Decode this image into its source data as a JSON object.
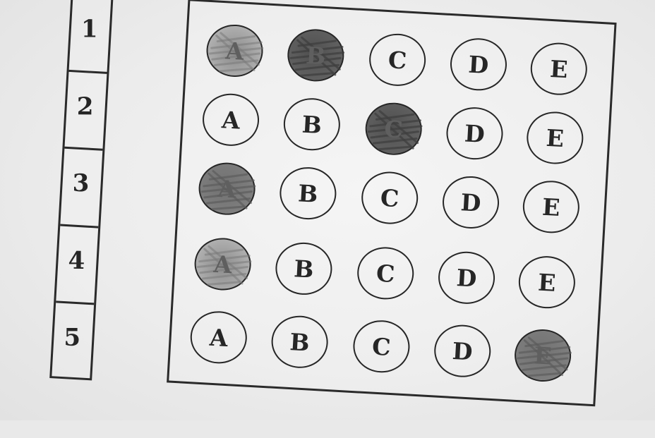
{
  "question_numbers": [
    "1",
    "2",
    "3",
    "4",
    "5"
  ],
  "answers": [
    {
      "number": "1",
      "options": [
        {
          "letter": "A",
          "marked": true,
          "shade": "light"
        },
        {
          "letter": "B",
          "marked": true,
          "shade": "dark"
        },
        {
          "letter": "C",
          "marked": false,
          "shade": "none"
        },
        {
          "letter": "D",
          "marked": false,
          "shade": "none"
        },
        {
          "letter": "E",
          "marked": false,
          "shade": "none"
        }
      ]
    },
    {
      "number": "2",
      "options": [
        {
          "letter": "A",
          "marked": false,
          "shade": "none"
        },
        {
          "letter": "B",
          "marked": false,
          "shade": "none"
        },
        {
          "letter": "C",
          "marked": true,
          "shade": "dark"
        },
        {
          "letter": "D",
          "marked": false,
          "shade": "none"
        },
        {
          "letter": "E",
          "marked": false,
          "shade": "none"
        }
      ]
    },
    {
      "number": "3",
      "options": [
        {
          "letter": "A",
          "marked": true,
          "shade": "medium"
        },
        {
          "letter": "B",
          "marked": false,
          "shade": "none"
        },
        {
          "letter": "C",
          "marked": false,
          "shade": "none"
        },
        {
          "letter": "D",
          "marked": false,
          "shade": "none"
        },
        {
          "letter": "E",
          "marked": false,
          "shade": "none"
        }
      ]
    },
    {
      "number": "4",
      "options": [
        {
          "letter": "A",
          "marked": true,
          "shade": "light"
        },
        {
          "letter": "B",
          "marked": false,
          "shade": "none"
        },
        {
          "letter": "C",
          "marked": false,
          "shade": "none"
        },
        {
          "letter": "D",
          "marked": false,
          "shade": "none"
        },
        {
          "letter": "E",
          "marked": false,
          "shade": "none"
        }
      ]
    },
    {
      "number": "5",
      "options": [
        {
          "letter": "A",
          "marked": false,
          "shade": "none"
        },
        {
          "letter": "B",
          "marked": false,
          "shade": "none"
        },
        {
          "letter": "C",
          "marked": false,
          "shade": "none"
        },
        {
          "letter": "D",
          "marked": false,
          "shade": "none"
        },
        {
          "letter": "E",
          "marked": true,
          "shade": "medium"
        }
      ]
    }
  ]
}
